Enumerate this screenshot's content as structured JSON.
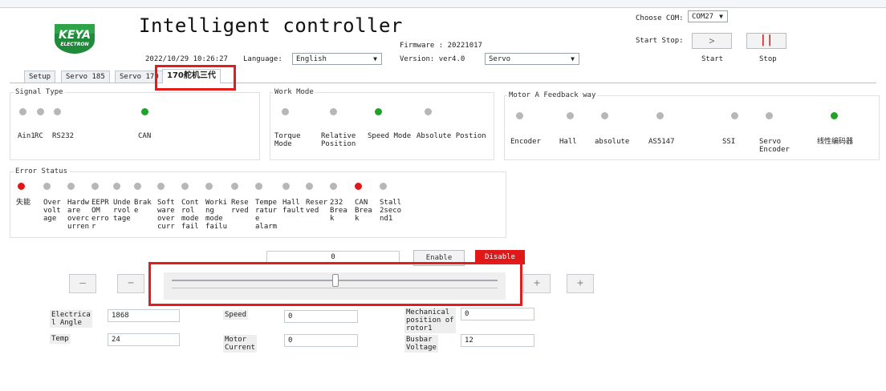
{
  "app": {
    "title": "Intelligent controller",
    "logo_text": "KEYA",
    "logo_sub": "ELECTRON",
    "datetime": "2022/10/29 10:26:27",
    "language_label": "Language:",
    "language_value": "English",
    "firmware": "Firmware : 20221017",
    "version": "Version: ver4.0",
    "mode_value": "Servo",
    "com_label": "Choose COM:",
    "com_value": "COM27",
    "start_stop_label": "Start Stop:",
    "start_label": "Start",
    "stop_label": "Stop",
    "start_icon": "play-arrow-icon",
    "stop_icon": "pause-icon",
    "stop_color": "#e01818"
  },
  "tabs": [
    {
      "label": "Setup"
    },
    {
      "label": "Servo 185"
    },
    {
      "label": "Servo 170"
    },
    {
      "label": "170舵机三代"
    }
  ],
  "signal_type": {
    "title": "Signal Type",
    "items": [
      {
        "label": "Ain1",
        "state": "off"
      },
      {
        "label": "RC",
        "state": "off"
      },
      {
        "label": "RS232",
        "state": "off"
      },
      {
        "label": "CAN",
        "state": "on"
      }
    ]
  },
  "work_mode": {
    "title": "Work Mode",
    "items": [
      {
        "label": "Torque\nMode",
        "state": "off"
      },
      {
        "label": "Relative\nPosition",
        "state": "off"
      },
      {
        "label": "Speed Mode",
        "state": "on"
      },
      {
        "label": "Absolute Postion",
        "state": "off"
      }
    ]
  },
  "feedback": {
    "title": "Motor A Feedback way",
    "items": [
      {
        "label": "Encoder",
        "state": "off"
      },
      {
        "label": "Hall",
        "state": "off"
      },
      {
        "label": "absolute",
        "state": "off"
      },
      {
        "label": "AS5147",
        "state": "off"
      },
      {
        "label": "SSI",
        "state": "off"
      },
      {
        "label": "Servo\nEncoder",
        "state": "off"
      },
      {
        "label": "线性编码器",
        "state": "on"
      }
    ]
  },
  "error_status": {
    "title": "Error Status",
    "items": [
      {
        "label": "失能",
        "state": "error"
      },
      {
        "label": "Over\nvolt\nage",
        "state": "off"
      },
      {
        "label": "Hardw\nare\noverc\nurren",
        "state": "off"
      },
      {
        "label": "EEPR\nOM\nerro\nr",
        "state": "off"
      },
      {
        "label": "Unde\nrvol\ntage",
        "state": "off"
      },
      {
        "label": "Brak\ne",
        "state": "off"
      },
      {
        "label": "Soft\nware\nover\ncurr",
        "state": "off"
      },
      {
        "label": "Cont\nrol\nmode\nfail",
        "state": "off"
      },
      {
        "label": "Worki\nng\nmode\nfailu",
        "state": "off"
      },
      {
        "label": "Rese\nrved",
        "state": "off"
      },
      {
        "label": "Tempe\nratur\ne\nalarm",
        "state": "off"
      },
      {
        "label": "Hall\nfault",
        "state": "off"
      },
      {
        "label": "Reser\nved",
        "state": "off"
      },
      {
        "label": "232\nBrea\nk",
        "state": "off"
      },
      {
        "label": "CAN\nBrea\nk",
        "state": "error"
      },
      {
        "label": "Stall\n2seco\nnd1",
        "state": "off"
      }
    ]
  },
  "control": {
    "value": "0",
    "enable_label": "Enable",
    "disable_label": "Disable",
    "disable_color": "#e01818",
    "minus_label": "—",
    "minus_small_label": "−",
    "plus_small_label": "+",
    "plus_label": "+",
    "slider_level_fraction": 0.5
  },
  "readouts": [
    {
      "label": "Electrica\nl Angle",
      "value": "1868"
    },
    {
      "label": "Temp",
      "value": "24"
    },
    {
      "label": "Speed",
      "value": "0"
    },
    {
      "label": "Motor\nCurrent",
      "value": "0"
    },
    {
      "label": "Mechanical\nposition of\nrotor1",
      "value": "0"
    },
    {
      "label": "Busbar\nVoltage",
      "value": "12"
    }
  ]
}
